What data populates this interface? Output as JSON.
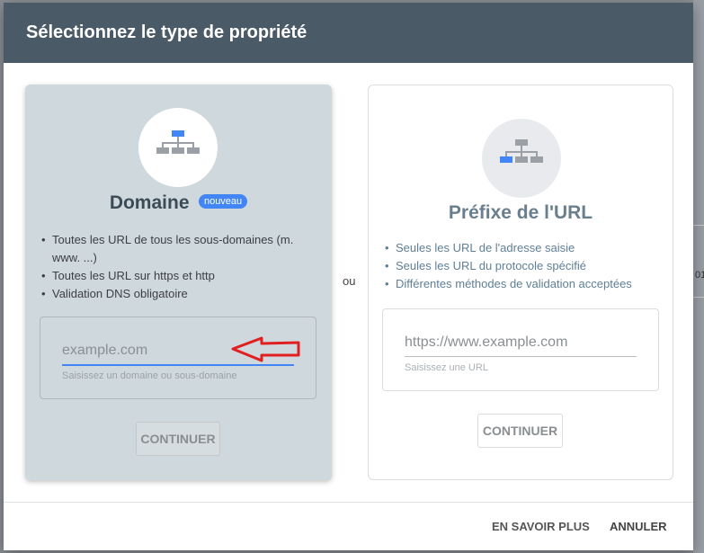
{
  "dialog": {
    "title": "Sélectionnez le type de propriété"
  },
  "domain_card": {
    "title": "Domaine",
    "badge": "nouveau",
    "bullets": [
      "Toutes les URL de tous les sous-domaines (m. www. ...)",
      "Toutes les URL sur https et http",
      "Validation DNS obligatoire"
    ],
    "input_placeholder": "example.com",
    "input_value": "",
    "helper": "Saisissez un domaine ou sous-domaine",
    "button": "CONTINUER",
    "icon": "sitemap-top-highlight-icon"
  },
  "separator": "ou",
  "url_card": {
    "title": "Préfixe de l'URL",
    "bullets": [
      "Seules les URL de l'adresse saisie",
      "Seules les URL du protocole spécifié",
      "Différentes méthodes de validation acceptées"
    ],
    "input_placeholder": "https://www.example.com",
    "input_value": "",
    "helper": "Saisissez une URL",
    "button": "CONTINUER",
    "icon": "sitemap-left-highlight-icon"
  },
  "footer": {
    "learn_more": "EN SAVOIR PLUS",
    "cancel": "ANNULER"
  },
  "colors": {
    "header": "#4a5a66",
    "accent": "#4285f4",
    "annotation_arrow": "#e02020"
  }
}
